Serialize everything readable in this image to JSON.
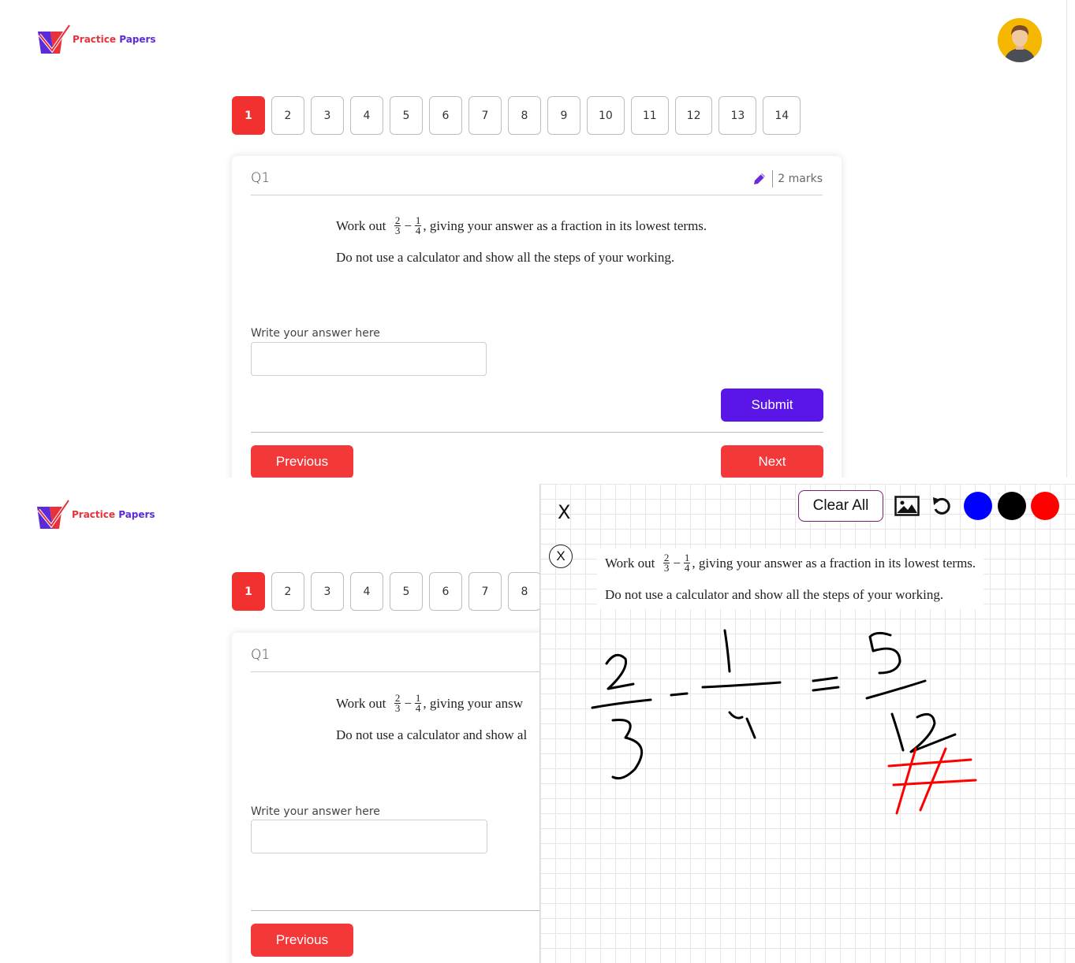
{
  "brand": {
    "word1": "Practice",
    "word2": "Papers"
  },
  "pagination": [
    "1",
    "2",
    "3",
    "4",
    "5",
    "6",
    "7",
    "8",
    "9",
    "10",
    "11",
    "12",
    "13",
    "14"
  ],
  "pagination_visible_bottom": [
    "1",
    "2",
    "3",
    "4",
    "5",
    "6",
    "7",
    "8"
  ],
  "active_page": "1",
  "question": {
    "number": "Q1",
    "marks": "2 marks",
    "prefix": "Work out",
    "frac1": {
      "num": "2",
      "den": "3"
    },
    "operator": "−",
    "frac2": {
      "num": "1",
      "den": "4"
    },
    "suffix": ", giving your answer as a fraction in its lowest terms.",
    "suffix_cut": ", giving your answ",
    "instruction": "Do not use a calculator and show all the steps of your working.",
    "instruction_cut": "Do not use a calculator and show al"
  },
  "answer": {
    "label": "Write your answer here",
    "value": ""
  },
  "buttons": {
    "submit": "Submit",
    "previous": "Previous",
    "next": "Next"
  },
  "overlay": {
    "close_label": "X",
    "close_circle_label": "X",
    "clear_all": "Clear All",
    "colors": {
      "blue": "#0000ff",
      "black": "#000000",
      "red": "#ff0000"
    }
  },
  "icons": {
    "edit": "pencil-icon",
    "image": "image-icon",
    "undo": "undo-icon",
    "profile": "avatar-icon"
  }
}
